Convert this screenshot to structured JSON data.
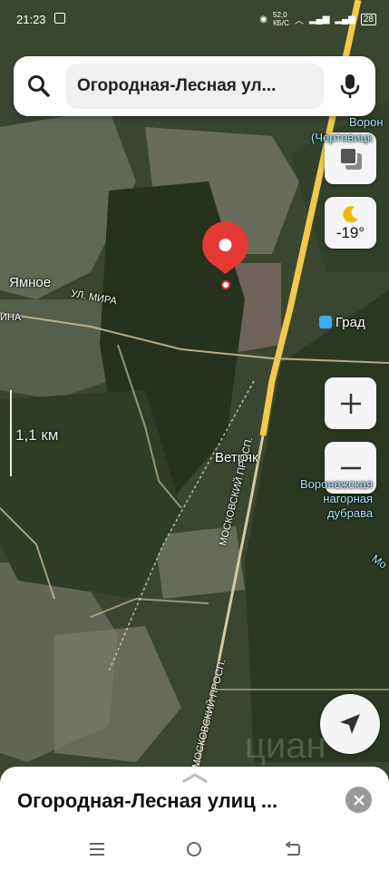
{
  "status_bar": {
    "time": "21:23",
    "net_speed": "52,0\nКБ/С",
    "battery": "28"
  },
  "search": {
    "query": "Огородная-Лесная ул..."
  },
  "weather": {
    "temperature": "-19°"
  },
  "map": {
    "scale_label": "1,1 км",
    "places": {
      "yamnoe": "Ямное",
      "ul_mira": "ул. Мира",
      "vetryak": "Ветряк",
      "grad": "Град",
      "dubrava_1": "Воронежская",
      "dubrava_2": "нагорная",
      "dubrava_3": "дубрава",
      "voron": "Ворон",
      "chertovitsk": "(Чертовицк",
      "moskovsky_1": "Московский просп.",
      "moskovsky_2": "Московский просп.",
      "ina": "ина",
      "mo": "Мо"
    },
    "watermark": "циан"
  },
  "bottom_sheet": {
    "title": "Огородная-Лесная улиц ..."
  },
  "colors": {
    "marker": "#e53935",
    "road_yellow": "#f2c94c",
    "forest": "#2c3a23"
  }
}
